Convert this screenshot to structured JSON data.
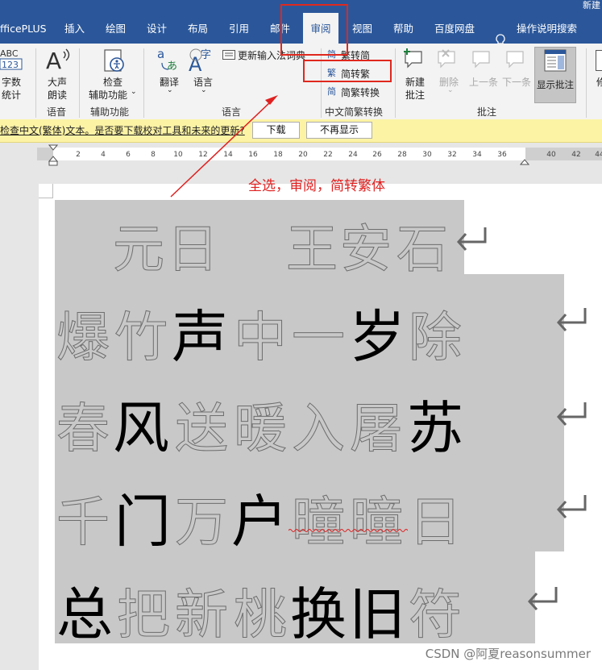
{
  "window": {
    "doc_title_partial": "新建"
  },
  "ribbon_tabs": [
    {
      "label": "fficePLUS"
    },
    {
      "label": "插入"
    },
    {
      "label": "绘图"
    },
    {
      "label": "设计"
    },
    {
      "label": "布局"
    },
    {
      "label": "引用"
    },
    {
      "label": "邮件"
    },
    {
      "label": "审阅"
    },
    {
      "label": "视图"
    },
    {
      "label": "帮助"
    },
    {
      "label": "百度网盘"
    }
  ],
  "tell_me": "操作说明搜索",
  "ribbon": {
    "word_count": {
      "icon_text": "ABC 123",
      "line1": "字数",
      "line2": "统计"
    },
    "read_aloud": {
      "line1": "大声",
      "line2": "朗读",
      "group": "语音"
    },
    "accessibility": {
      "line1": "检查",
      "line2": "辅助功能",
      "group": "辅助功能"
    },
    "translate": {
      "label": "翻译"
    },
    "language": {
      "label": "语言",
      "group": "语言"
    },
    "update_ime": "更新输入法词典",
    "trad_to_simp": "繁转简",
    "simp_to_trad": "简转繁",
    "convert": "简繁转换",
    "chinese_group": "中文简繁转换",
    "new_comment": {
      "line1": "新建",
      "line2": "批注"
    },
    "delete": "删除",
    "prev": "上一条",
    "next": "下一条",
    "show_comments": "显示批注",
    "comments_group": "批注",
    "cut_label": "修"
  },
  "message_bar": {
    "text": "检查中文(繁体)文本。是否要下载校对工具和未来的更新?",
    "download": "下载",
    "dont_show": "不再显示"
  },
  "ruler": [
    "2",
    "4",
    "6",
    "8",
    "10",
    "12",
    "14",
    "16",
    "18",
    "20",
    "22",
    "24",
    "26",
    "28",
    "30",
    "32",
    "34",
    "36",
    "40",
    "42",
    "44"
  ],
  "annotation": "全选，审阅，简转繁体",
  "poem": [
    [
      "元",
      "日",
      "王",
      "安",
      "石"
    ],
    [
      "爆",
      "竹",
      "声",
      "中",
      "一",
      "岁",
      "除"
    ],
    [
      "春",
      "风",
      "送",
      "暖",
      "入",
      "屠",
      "苏"
    ],
    [
      "千",
      "门",
      "万",
      "户",
      "曈",
      "曈",
      "日"
    ],
    [
      "总",
      "把",
      "新",
      "桃",
      "换",
      "旧",
      "符"
    ]
  ],
  "watermark": "CSDN @阿夏reasonsummer",
  "colors": {
    "title_bar": "#2b579a",
    "selection": "#c8c8c8",
    "annotation_red": "#e02020",
    "message_bar": "#fcf3a5"
  }
}
